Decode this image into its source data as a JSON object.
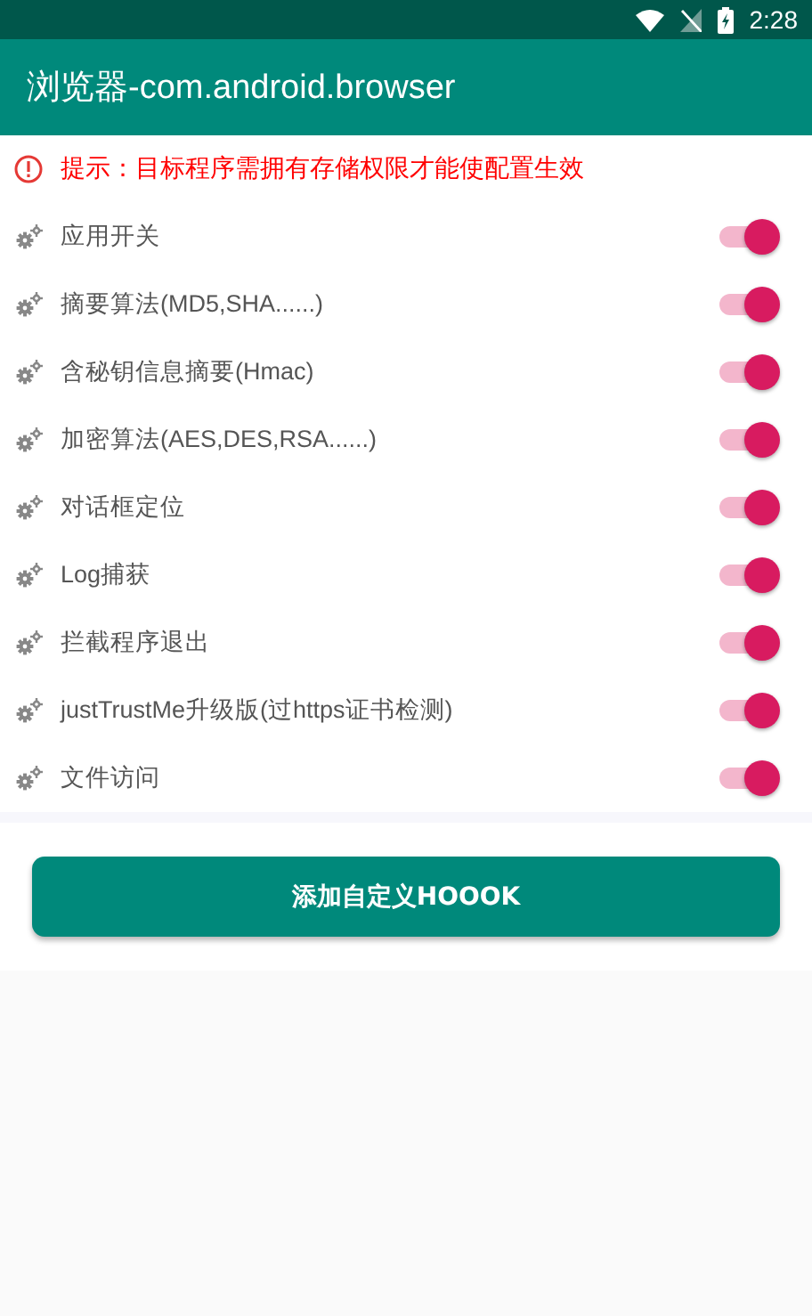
{
  "status_bar": {
    "time": "2:28"
  },
  "app_bar": {
    "title": "浏览器-com.android.browser"
  },
  "notice": "提示：目标程序需拥有存储权限才能使配置生效",
  "settings": [
    {
      "label": "应用开关",
      "on": true
    },
    {
      "label": "摘要算法(MD5,SHA......)",
      "on": true
    },
    {
      "label": "含秘钥信息摘要(Hmac)",
      "on": true
    },
    {
      "label": "加密算法(AES,DES,RSA......)",
      "on": true
    },
    {
      "label": "对话框定位",
      "on": true
    },
    {
      "label": "Log捕获",
      "on": true
    },
    {
      "label": "拦截程序退出",
      "on": true
    },
    {
      "label": "justTrustMe升级版(过https证书检测)",
      "on": true
    },
    {
      "label": "文件访问",
      "on": true
    }
  ],
  "add_button": "添加自定义HOOOK"
}
